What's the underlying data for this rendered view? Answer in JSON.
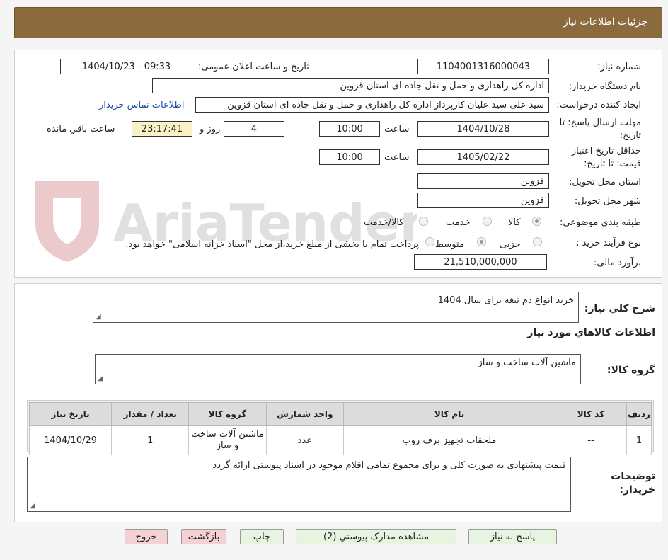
{
  "header": {
    "title": "جزئیات اطلاعات نیاز"
  },
  "watermark": {
    "text": "AriaTender.neT"
  },
  "form": {
    "need_number_label": "شماره نیاز:",
    "need_number": "1104001316000043",
    "announce_label": "تاریخ و ساعت اعلان عمومی:",
    "announce_value": "1404/10/23 - 09:33",
    "buyer_org_label": "نام دستگاه خریدار:",
    "buyer_org": "اداره کل راهداری و حمل و نقل جاده ای استان قزوین",
    "requester_label": "ایجاد کننده درخواست:",
    "requester": "سید علی سید علیان کارپرداز اداره کل راهداری و حمل و نقل جاده ای استان قزوین",
    "contact_link": "اطلاعات تماس خریدار",
    "deadline_label_1": "مهلت ارسال پاسخ: تا",
    "deadline_label_2": "تاریخ:",
    "deadline_date": "1404/10/28",
    "time_label": "ساعت",
    "deadline_time": "10:00",
    "days_value": "4",
    "days_label": "روز و",
    "remaining_time": "23:17:41",
    "remaining_label": "ساعت باقي مانده",
    "validity_label_1": "حداقل تاریخ اعتبار",
    "validity_label_2": "قیمت: تا تاریخ:",
    "validity_date": "1405/02/22",
    "validity_time": "10:00",
    "province_label": "استان محل تحویل:",
    "province": "قزوین",
    "city_label": "شهر محل تحویل:",
    "city": "قزوین",
    "category_label": "طبقه بندی موضوعی:",
    "category_options": [
      "کالا",
      "خدمت",
      "کالا/خدمت"
    ],
    "process_label": "نوع فرآیند خرید :",
    "process_options": [
      "جزیی",
      "متوسط"
    ],
    "process_note": "پرداخت تمام یا بخشی از مبلغ خرید،از محل \"اسناد خزانه اسلامی\" خواهد بود.",
    "budget_label": "برآورد مالی:",
    "budget": "21,510,000,000"
  },
  "summary": {
    "label": "شرح کلي نياز:",
    "value": "خرید انواع دم تیغه برای سال 1404",
    "goods_info_title": "اطلاعات کالاهاي مورد نياز",
    "goods_group_label": "گروه کالا:",
    "goods_group_value": "ماشین آلات ساخت و ساز"
  },
  "table": {
    "headers": [
      "رديف",
      "کد کالا",
      "نام کالا",
      "واحد شمارش",
      "گروه کالا",
      "تعداد / مقدار",
      "تاریخ نیاز"
    ],
    "rows": [
      [
        "1",
        "--",
        "ملحقات تجهیز برف روب",
        "عدد",
        "ماشین آلات ساخت و ساز",
        "1",
        "1404/10/29"
      ]
    ]
  },
  "buyer_notes": {
    "label_1": "توضیحات",
    "label_2": "خریدار:",
    "value": "قیمت پیشنهادی به صورت کلی و برای مجموع تمامی اقلام موجود در اسناد پیوستی ارائه گردد"
  },
  "buttons": {
    "respond": "پاسخ به نياز",
    "attachments": "مشاهده مدارک پيوستي (2)",
    "print": "چاپ",
    "back": "بازگشت",
    "exit": "خروج"
  }
}
